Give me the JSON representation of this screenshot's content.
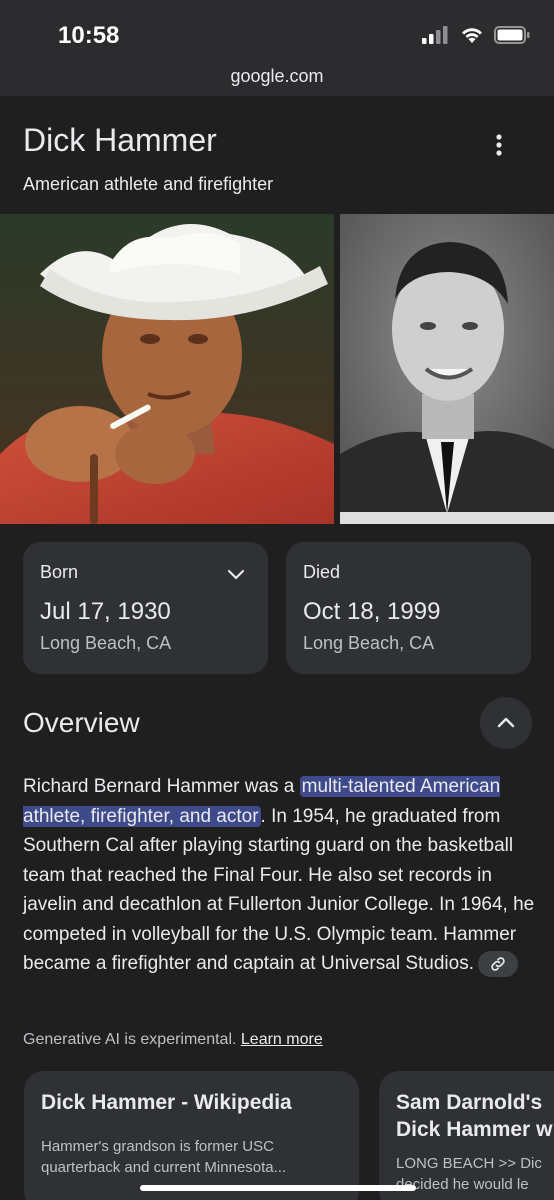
{
  "status_bar": {
    "time": "10:58"
  },
  "browser": {
    "url": "google.com"
  },
  "header": {
    "title": "Dick Hammer",
    "subtitle": "American athlete and firefighter",
    "more_icon": "more-vert-icon"
  },
  "images": [
    {
      "name": "cowboy-portrait-photo"
    },
    {
      "name": "black-and-white-portrait-photo"
    }
  ],
  "facts": {
    "born": {
      "label": "Born",
      "date": "Jul 17, 1930",
      "place": "Long Beach, CA"
    },
    "died": {
      "label": "Died",
      "date": "Oct 18, 1999",
      "place": "Long Beach, CA"
    }
  },
  "overview": {
    "heading": "Overview",
    "text_before": "Richard Bernard Hammer was a ",
    "highlight": "multi-talented American athlete, firefighter, and actor",
    "text_after": ". In 1954, he graduated from Southern Cal after playing starting guard on the basketball team that reached the Final Four. He also set records in javelin and decathlon at Fullerton Junior College. In 1964, he competed in volleyball for the U.S. Olympic team. Hammer became a firefighter and captain at Universal Studios."
  },
  "ai_note": {
    "text": "Generative AI is experimental.",
    "link": "Learn more"
  },
  "sources": [
    {
      "title": "Dick Hammer - Wikipedia",
      "snippet_line1": "Hammer's grandson is former USC",
      "snippet_line2": "quarterback and current Minnesota..."
    },
    {
      "title_line1": "Sam Darnold's",
      "title_line2": "Dick Hammer w",
      "snippet_line1": "LONG BEACH >> Dic",
      "snippet_line2": "decided he would le"
    }
  ],
  "colors": {
    "background": "#1f1f1f",
    "card": "#303134",
    "highlight": "#3e4a8a"
  }
}
